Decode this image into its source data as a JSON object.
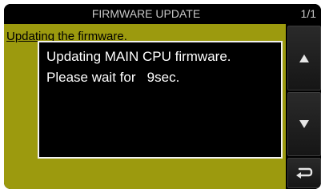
{
  "header": {
    "title": "FIRMWARE UPDATE",
    "page_indicator": "1/1"
  },
  "main": {
    "status_text": "Updating the firmware."
  },
  "dialog": {
    "line1": "Updating MAIN CPU firmware.",
    "line2": "Please wait for   9sec."
  },
  "side_buttons": [
    {
      "icon": "arrow-up-icon"
    },
    {
      "icon": "arrow-down-icon"
    },
    {
      "icon": "return-icon"
    }
  ],
  "colors": {
    "content_background": "#9c9a0e",
    "dialog_border": "#f2f2f2",
    "title_text": "#c8c8c8"
  }
}
